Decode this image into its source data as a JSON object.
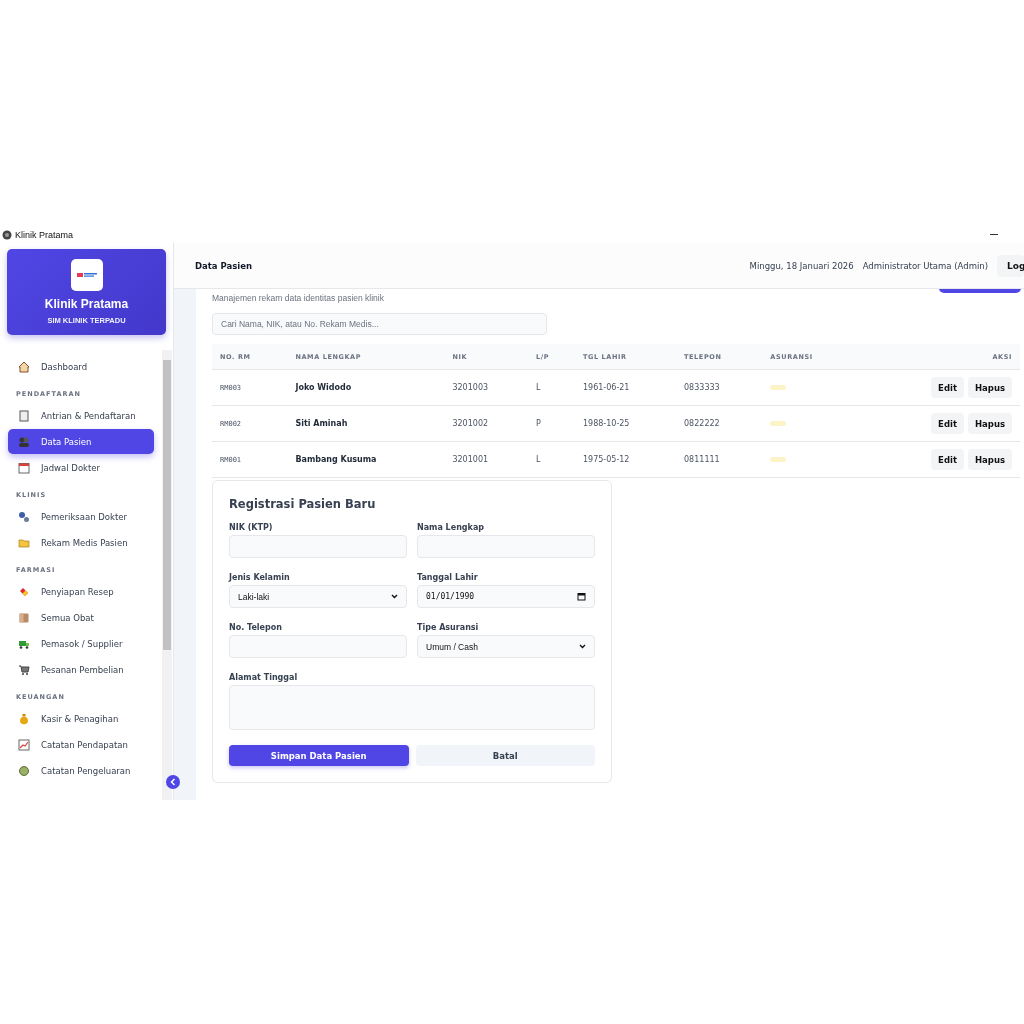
{
  "window": {
    "title": "Klinik Pratama"
  },
  "sidebar": {
    "brand": "Klinik Pratama",
    "tagline": "SIM KLINIK TERPADU",
    "sections": [
      {
        "items": [
          {
            "label": "Dashboard",
            "selected": false
          }
        ]
      },
      {
        "heading": "PENDAFTARAN",
        "items": [
          {
            "label": "Antrian & Pendaftaran",
            "selected": false
          },
          {
            "label": "Data Pasien",
            "selected": true
          },
          {
            "label": "Jadwal Dokter",
            "selected": false
          }
        ]
      },
      {
        "heading": "KLINIS",
        "items": [
          {
            "label": "Pemeriksaan Dokter",
            "selected": false
          },
          {
            "label": "Rekam Medis Pasien",
            "selected": false
          }
        ]
      },
      {
        "heading": "FARMASI",
        "items": [
          {
            "label": "Penyiapan Resep",
            "selected": false
          },
          {
            "label": "Semua Obat",
            "selected": false
          },
          {
            "label": "Pemasok / Supplier",
            "selected": false
          },
          {
            "label": "Pesanan Pembelian",
            "selected": false
          }
        ]
      },
      {
        "heading": "KEUANGAN",
        "items": [
          {
            "label": "Kasir & Penagihan",
            "selected": false
          },
          {
            "label": "Catatan Pendapatan",
            "selected": false
          },
          {
            "label": "Catatan Pengeluaran",
            "selected": false
          }
        ]
      }
    ]
  },
  "header": {
    "title": "Data Pasien",
    "date": "Minggu, 18 Januari 2026",
    "user": "Administrator Utama (Admin)",
    "logout": "Log"
  },
  "subtitle": "Manajemen rekam data identitas pasien klinik",
  "search": {
    "placeholder": "Cari Nama, NIK, atau No. Rekam Medis..."
  },
  "table": {
    "columns": [
      "NO. RM",
      "NAMA LENGKAP",
      "NIK",
      "L/P",
      "TGL LAHIR",
      "TELEPON",
      "ASURANSI",
      "AKSI"
    ],
    "rows": [
      {
        "rm": "RM003",
        "name": "Joko Widodo",
        "nik": "3201003",
        "gender": "L",
        "birth": "1961-06-21",
        "phone": "0833333",
        "actions": [
          "Edit",
          "Hapus"
        ]
      },
      {
        "rm": "RM002",
        "name": "Siti Aminah",
        "nik": "3201002",
        "gender": "P",
        "birth": "1988-10-25",
        "phone": "0822222",
        "actions": [
          "Edit",
          "Hapus"
        ]
      },
      {
        "rm": "RM001",
        "name": "Bambang Kusuma",
        "nik": "3201001",
        "gender": "L",
        "birth": "1975-05-12",
        "phone": "0811111",
        "actions": [
          "Edit",
          "Hapus"
        ]
      }
    ]
  },
  "form": {
    "title": "Registrasi Pasien Baru",
    "fields": [
      {
        "label": "NIK (KTP)",
        "kind": "text"
      },
      {
        "label": "Nama Lengkap",
        "kind": "text"
      },
      {
        "label": "Jenis Kelamin",
        "kind": "select",
        "value": "Laki-laki"
      },
      {
        "label": "Tanggal Lahir",
        "kind": "date",
        "value": "01/01/1990"
      },
      {
        "label": "No. Telepon",
        "kind": "text"
      },
      {
        "label": "Tipe Asuransi",
        "kind": "select",
        "value": "Umum / Cash"
      },
      {
        "label": "Alamat Tinggal",
        "kind": "textarea"
      }
    ],
    "submit": "Simpan Data Pasien",
    "cancel": "Batal"
  }
}
